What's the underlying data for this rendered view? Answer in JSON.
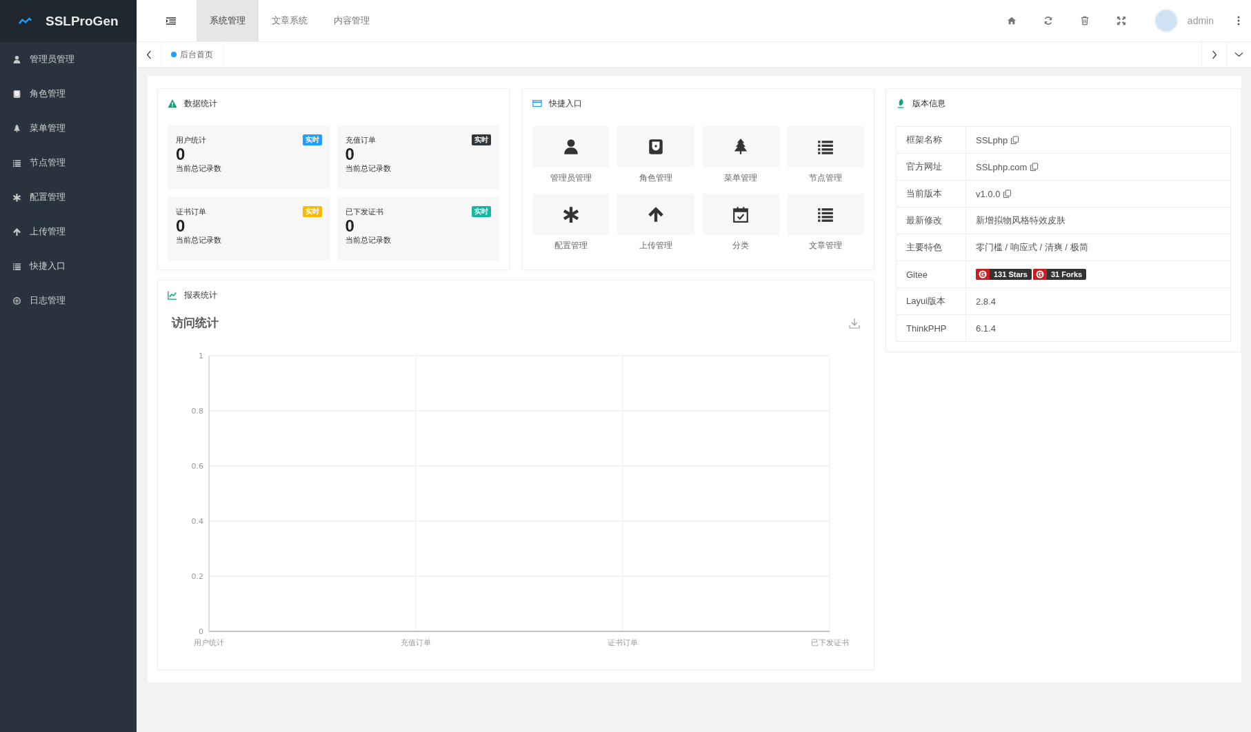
{
  "logo": {
    "title": "SSLProGen"
  },
  "top_tabs": [
    {
      "label": "系统管理",
      "selected": true
    },
    {
      "label": "文章系统",
      "selected": false
    },
    {
      "label": "内容管理",
      "selected": false
    }
  ],
  "user": {
    "name": "admin"
  },
  "sidebar": {
    "items": [
      {
        "label": "管理员管理"
      },
      {
        "label": "角色管理"
      },
      {
        "label": "菜单管理"
      },
      {
        "label": "节点管理"
      },
      {
        "label": "配置管理"
      },
      {
        "label": "上传管理"
      },
      {
        "label": "快捷入口"
      },
      {
        "label": "日志管理"
      }
    ]
  },
  "page_tabs": [
    {
      "label": "后台首页",
      "selected": true
    }
  ],
  "stats": {
    "title": "数据统计",
    "cards": [
      {
        "label": "用户统计",
        "badge": "实时",
        "color": "#1e9fff",
        "value": "0",
        "caption": "当前总记录数"
      },
      {
        "label": "充值订单",
        "badge": "实时",
        "color": "#2f363c",
        "value": "0",
        "caption": "当前总记录数"
      },
      {
        "label": "证书订单",
        "badge": "实时",
        "color": "#ffb800",
        "value": "0",
        "caption": "当前总记录数"
      },
      {
        "label": "已下发证书",
        "badge": "实时",
        "color": "#16b7a0",
        "value": "0",
        "caption": "当前总记录数"
      }
    ]
  },
  "shortcuts": {
    "title": "快捷入口",
    "items": [
      {
        "label": "管理员管理"
      },
      {
        "label": "角色管理"
      },
      {
        "label": "菜单管理"
      },
      {
        "label": "节点管理"
      },
      {
        "label": "配置管理"
      },
      {
        "label": "上传管理"
      },
      {
        "label": "分类"
      },
      {
        "label": "文章管理"
      }
    ]
  },
  "version": {
    "title": "版本信息",
    "rows": [
      {
        "kind": "copy",
        "label": "框架名称",
        "value": "SSLphp"
      },
      {
        "kind": "copy",
        "label": "官方网址",
        "value": "SSLphp.com"
      },
      {
        "kind": "copy",
        "label": "当前版本",
        "value": "v1.0.0"
      },
      {
        "kind": "text",
        "label": "最新修改",
        "value": "新增拟物风格特效皮肤"
      },
      {
        "kind": "text",
        "label": "主要特色",
        "value": "零门槛 / 响应式 / 清爽 / 极简"
      },
      {
        "kind": "badges",
        "label": "Gitee",
        "badges": [
          "131 Stars",
          "31 Forks"
        ]
      },
      {
        "kind": "text",
        "label": "Layui版本",
        "value": "2.8.4"
      },
      {
        "kind": "text",
        "label": "ThinkPHP",
        "value": "6.1.4"
      }
    ]
  },
  "report": {
    "title": "报表统计",
    "chart_data": {
      "type": "line",
      "title": "访问统计",
      "categories": [
        "用户统计",
        "充值订单",
        "证书订单",
        "已下发证书"
      ],
      "series": [
        {
          "color": "#c0c4cc",
          "values": [
            0,
            0,
            0,
            0
          ]
        }
      ],
      "grid": true,
      "ylim": [
        0,
        1
      ],
      "yticks": [
        0,
        0.2,
        0.4,
        0.6,
        0.8,
        1
      ]
    }
  }
}
